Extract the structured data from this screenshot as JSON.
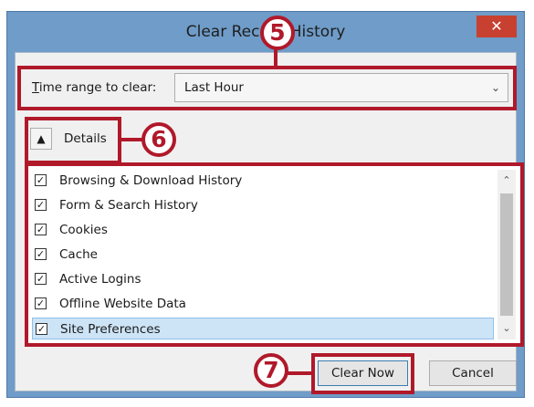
{
  "window": {
    "title": "Clear Recent History",
    "close_icon": "close-icon"
  },
  "time_range": {
    "label_accel": "T",
    "label_rest": "ime range to clear:",
    "value": "Last Hour",
    "chevron_icon": "chevron-down-icon"
  },
  "details": {
    "label": "Details",
    "toggle_icon": "chevron-up-icon"
  },
  "items": [
    {
      "label": "Browsing & Download History",
      "checked": true
    },
    {
      "label": "Form & Search History",
      "checked": true
    },
    {
      "label": "Cookies",
      "checked": true
    },
    {
      "label": "Cache",
      "checked": true
    },
    {
      "label": "Active Logins",
      "checked": true
    },
    {
      "label": "Offline Website Data",
      "checked": true
    },
    {
      "label": "Site Preferences",
      "checked": true,
      "selected": true
    }
  ],
  "buttons": {
    "clear": "Clear Now",
    "cancel": "Cancel"
  },
  "callouts": {
    "five": "5",
    "six": "6",
    "seven": "7"
  },
  "colors": {
    "callout": "#b0192a",
    "titlebar": "#6f9cc8",
    "close": "#c84030",
    "selection": "#cde4f7"
  }
}
